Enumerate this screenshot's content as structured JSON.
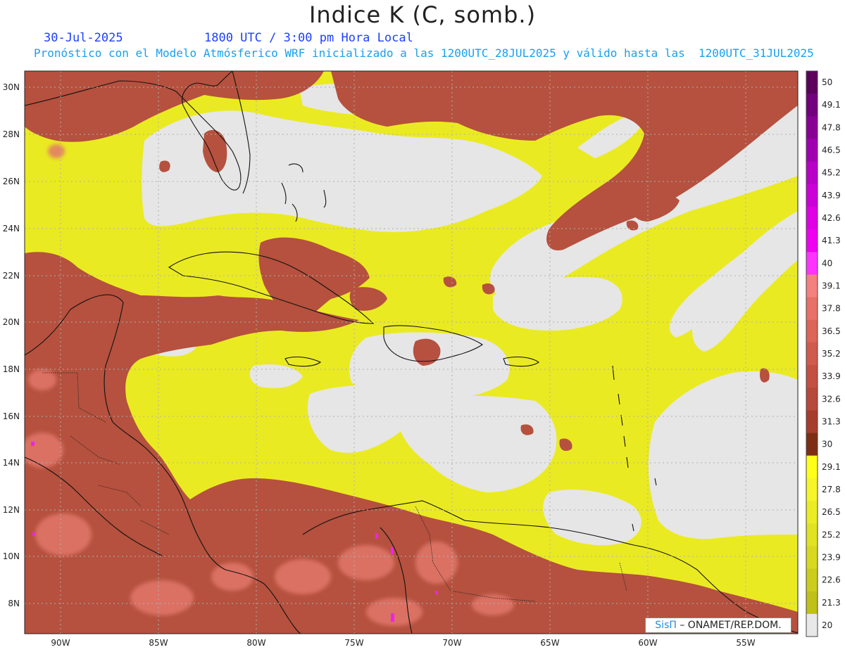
{
  "title": "Indice K (C, somb.)",
  "date": "30-Jul-2025",
  "valid_time": "1800 UTC / 3:00 pm Hora Local",
  "forecast_note": "Pronóstico con el Modelo Atmósferico WRF inicializado a las 1200UTC_28JUL2025 y válido hasta las  1200UTC_31JUL2025",
  "credit": {
    "brand": "SisΠ",
    "text": " – ONAMET/REP.DOM."
  },
  "map": {
    "lon_range": [
      -92,
      -52.5
    ],
    "lat_range": [
      6.8,
      30.6
    ],
    "lon_labels": [
      "90W",
      "85W",
      "80W",
      "75W",
      "70W",
      "65W",
      "60W",
      "55W"
    ],
    "lat_labels": [
      "30N",
      "28N",
      "26N",
      "24N",
      "22N",
      "20N",
      "18N",
      "16N",
      "14N",
      "12N",
      "10N",
      "8N"
    ],
    "background_color": "#e6e6e6"
  },
  "colorbar": {
    "labels": [
      "50",
      "49.1",
      "47.8",
      "46.5",
      "45.2",
      "43.9",
      "42.6",
      "41.3",
      "40",
      "39.1",
      "37.8",
      "36.5",
      "35.2",
      "33.9",
      "32.6",
      "31.3",
      "30",
      "29.1",
      "27.8",
      "26.5",
      "25.2",
      "23.9",
      "22.6",
      "21.3",
      "20"
    ],
    "colors_top_to_bottom": [
      "#5c005c",
      "#73007d",
      "#8a0096",
      "#a000b0",
      "#b800c8",
      "#cc00d8",
      "#e000e6",
      "#f000f0",
      "#ff33ff",
      "#f58080",
      "#e87068",
      "#dd6458",
      "#d05a4e",
      "#c45044",
      "#b8483c",
      "#a83c2c",
      "#7d2e14",
      "#ffff1a",
      "#f5f52a",
      "#ecec26",
      "#e2e224",
      "#d8d820",
      "#cccc1c",
      "#c0c018",
      "#e8e8e8"
    ]
  }
}
